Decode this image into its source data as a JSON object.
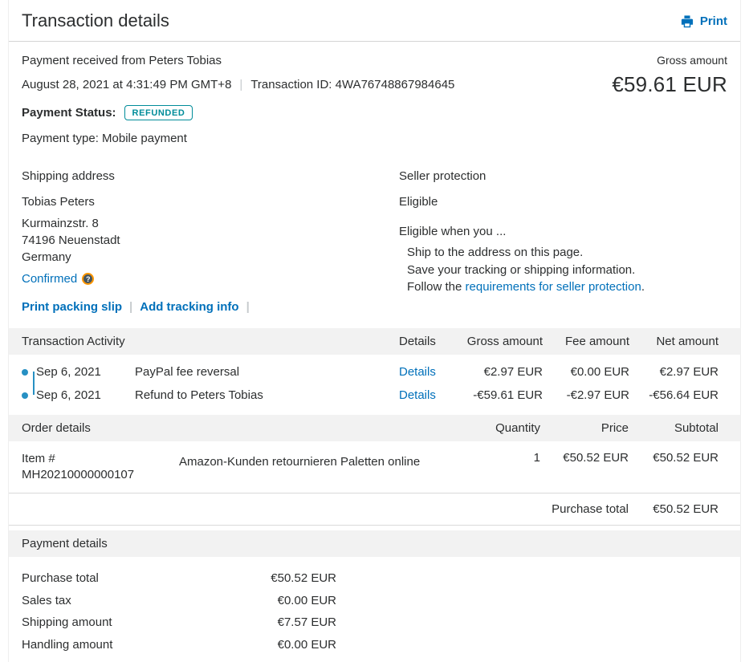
{
  "theme": {
    "link_blue": "#0070ba",
    "text_dark": "#2c2e2f",
    "badge_teal": "#008c99",
    "band_gray": "#f2f2f2",
    "timeline_blue": "#2790c3",
    "help_icon_orange": "#ff9600"
  },
  "misc": {
    "pipe": "|",
    "help_glyph": "?"
  },
  "header": {
    "title": "Transaction details",
    "print_label": "Print"
  },
  "summary": {
    "received_from": "Payment received from Peters Tobias",
    "gross_amount_label": "Gross amount",
    "date": "August 28, 2021 at 4:31:49 PM GMT+8",
    "transaction_id": "Transaction ID: 4WA76748867984645",
    "gross_amount": "€59.61 EUR",
    "payment_status_label": "Payment Status:",
    "payment_status": "REFUNDED",
    "payment_type": "Payment type: Mobile payment"
  },
  "shipping": {
    "title": "Shipping address",
    "name": "Tobias Peters",
    "address_lines": [
      "Kurmainzstr. 8",
      "74196 Neuenstadt",
      "Germany"
    ],
    "confirmed_label": "Confirmed",
    "links": [
      "Print packing slip",
      "Add tracking info"
    ]
  },
  "seller": {
    "title": "Seller protection",
    "status": "Eligible",
    "intro": "Eligible when you ...",
    "conditions": [
      "Ship to the address on this page.",
      "Save your tracking or shipping information."
    ],
    "follow_prefix": "Follow the",
    "follow_link": "requirements for seller protection",
    "follow_suffix": "."
  },
  "activity": {
    "title": "Transaction Activity",
    "headers": [
      "Details",
      "Gross amount",
      "Fee amount",
      "Net amount"
    ],
    "rows": [
      {
        "date": "Sep 6, 2021",
        "description": "PayPal fee reversal",
        "details_label": "Details",
        "gross": "€2.97 EUR",
        "fee": "€0.00 EUR",
        "net": "€2.97 EUR"
      },
      {
        "date": "Sep 6, 2021",
        "description": "Refund to Peters Tobias",
        "details_label": "Details",
        "gross": "-€59.61 EUR",
        "fee": "-€2.97 EUR",
        "net": "-€56.64 EUR"
      }
    ]
  },
  "order": {
    "title": "Order details",
    "headers": [
      "Quantity",
      "Price",
      "Subtotal"
    ],
    "item": {
      "number_label": "Item #",
      "number": "MH20210000000107",
      "description": "Amazon-Kunden retournieren Paletten online",
      "quantity": "1",
      "price": "€50.52 EUR",
      "subtotal": "€50.52 EUR"
    },
    "purchase_total_label": "Purchase total",
    "purchase_total": "€50.52 EUR"
  },
  "payment": {
    "title": "Payment details",
    "rows": [
      {
        "label": "Purchase total",
        "value": "€50.52 EUR"
      },
      {
        "label": "Sales tax",
        "value": "€0.00 EUR"
      },
      {
        "label": "Shipping amount",
        "value": "€7.57 EUR"
      },
      {
        "label": "Handling amount",
        "value": "€0.00 EUR"
      }
    ]
  }
}
